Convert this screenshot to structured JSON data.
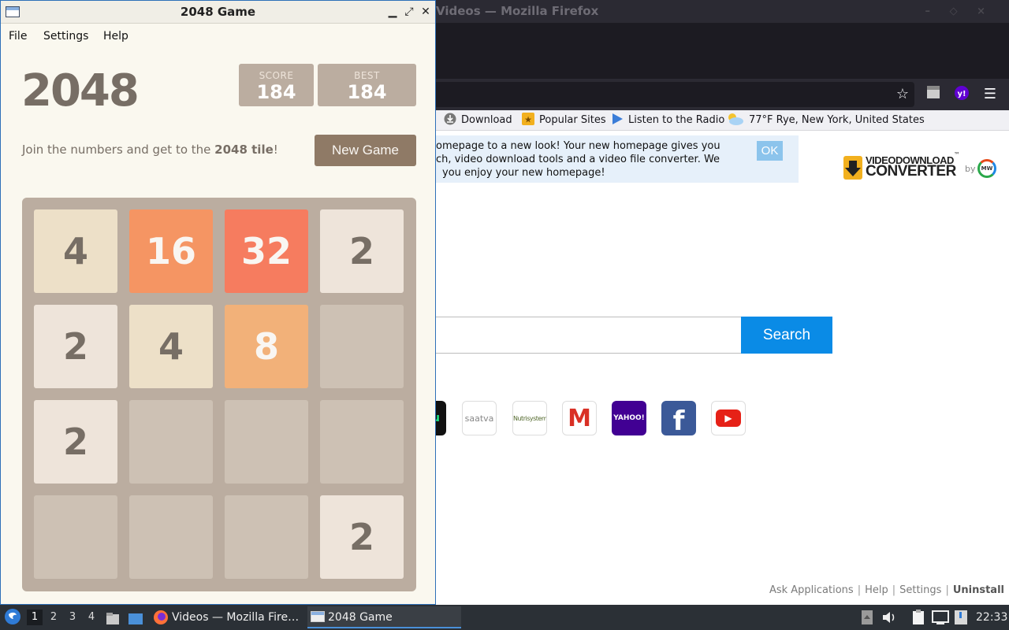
{
  "firefox": {
    "window_title": "Videos — Mozilla Firefox",
    "bookmarks": [
      {
        "label": "Download"
      },
      {
        "label": "Popular Sites"
      },
      {
        "label": "Listen to the Radio"
      },
      {
        "label": "77°F Rye, New York, United States"
      }
    ],
    "banner": {
      "lines": [
        "omepage to a new look! Your new homepage gives you",
        "ch, video download tools and a video file converter. We",
        "you enjoy your new homepage!"
      ],
      "ok_label": "OK"
    },
    "logo": {
      "line1": "VIDEODOWNLOAD",
      "line2": "CONVERTER",
      "by": "by",
      "badge": "MW",
      "tm": "™"
    },
    "search_button": "Search",
    "quick_links": [
      {
        "name": "saatva",
        "label": "saatva"
      },
      {
        "name": "nutrisystem",
        "label": "Nutrisystem"
      },
      {
        "name": "gmail",
        "label": "M"
      },
      {
        "name": "yahoo",
        "label": "YAHOO!"
      },
      {
        "name": "facebook",
        "label": "f"
      },
      {
        "name": "youtube",
        "label": "▶"
      }
    ],
    "footer": {
      "ask": "Ask Applications",
      "help": "Help",
      "settings": "Settings",
      "uninstall": "Uninstall",
      "sep": "|"
    }
  },
  "game": {
    "window_title": "2048 Game",
    "menu": {
      "file": "File",
      "settings": "Settings",
      "help": "Help"
    },
    "title": "2048",
    "score_label": "SCORE",
    "score": "184",
    "best_label": "BEST",
    "best": "184",
    "intro_prefix": "Join the numbers and get to the ",
    "intro_bold": "2048 tile",
    "intro_suffix": "!",
    "new_game": "New Game",
    "board": [
      [
        "4",
        "16",
        "32",
        "2"
      ],
      [
        "2",
        "4",
        "8",
        ""
      ],
      [
        "2",
        "",
        "",
        ""
      ],
      [
        "",
        "",
        "",
        "2"
      ]
    ],
    "colors": {
      "empty": "#cdc1b4",
      "2": "#eee4da",
      "4": "#ede0c8",
      "8": "#f2b179",
      "16": "#f59563",
      "32": "#f67c5f"
    }
  },
  "taskbar": {
    "workspaces": [
      "1",
      "2",
      "3",
      "4"
    ],
    "tasks": [
      {
        "label": "Videos — Mozilla Fire…",
        "active": false
      },
      {
        "label": "2048 Game",
        "active": true
      }
    ],
    "clock": "22:33"
  }
}
